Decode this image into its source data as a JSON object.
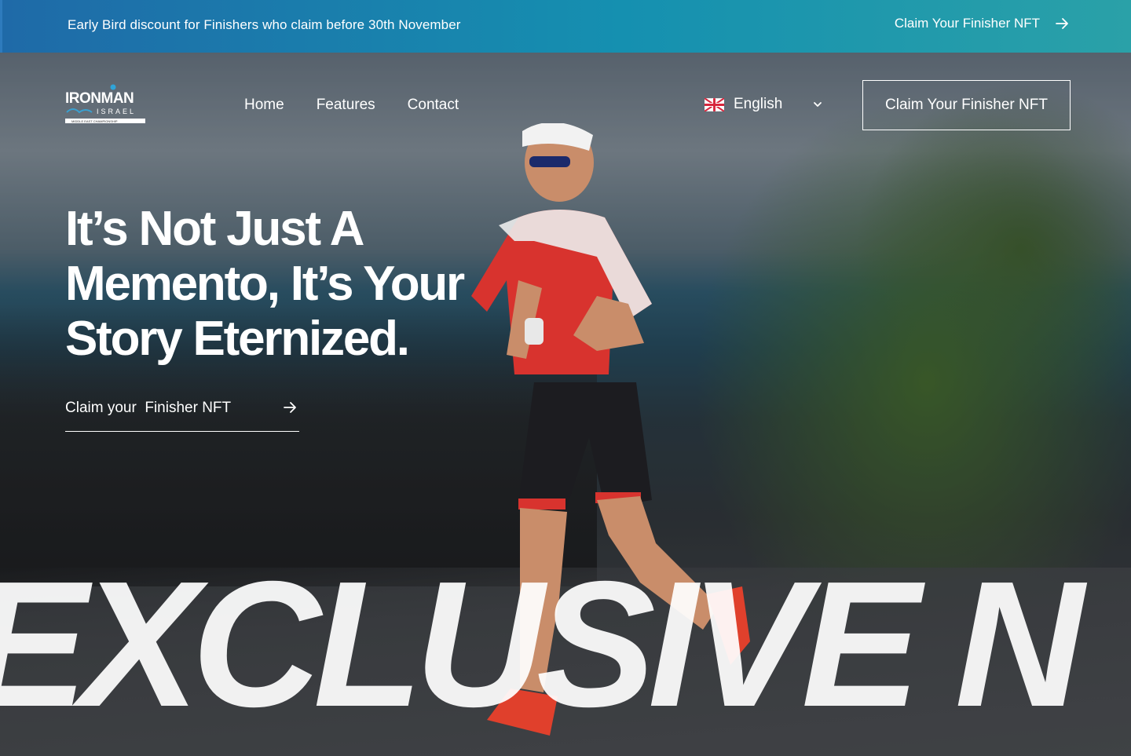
{
  "promo": {
    "text": "Early Bird discount for Finishers who claim before 30th November",
    "cta_label": "Claim Your Finisher NFT",
    "cta_icon": "arrow-right-icon"
  },
  "brand": {
    "logo_text": "IRONMAN",
    "logo_subtext": "ISRAEL",
    "logo_tagline": "MIDDLE EAST CHAMPIONSHIP"
  },
  "nav": {
    "items": [
      {
        "label": "Home"
      },
      {
        "label": "Features"
      },
      {
        "label": "Contact"
      }
    ]
  },
  "language": {
    "selected": "English",
    "flag_icon": "uk-flag-icon",
    "chevron_icon": "chevron-down-icon"
  },
  "header": {
    "cta_label": "Claim Your Finisher NFT"
  },
  "hero": {
    "headline_line1": "It’s Not Just A",
    "headline_line2": "Memento, It’s Your",
    "headline_line3": "Story Eternized.",
    "link_label": "Claim your  Finisher NFT",
    "link_icon": "arrow-right-icon",
    "marquee_text": "EXCLUSIVE N"
  },
  "colors": {
    "promo_start": "#1f6aa8",
    "promo_end": "#2aa1a8",
    "text": "#ffffff"
  }
}
